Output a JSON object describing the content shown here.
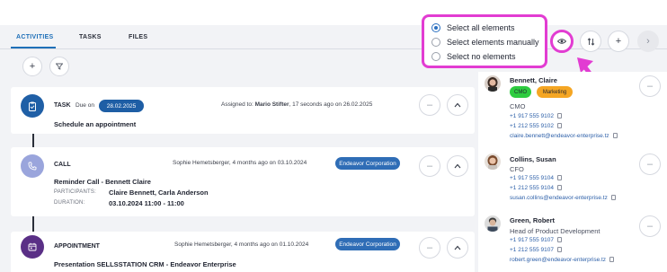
{
  "tabs": [
    {
      "label": "ACTIVITIES",
      "active": true
    },
    {
      "label": "TASKS",
      "active": false
    },
    {
      "label": "FILES",
      "active": false
    }
  ],
  "toolbar": {
    "add_symbol": "+",
    "collapse_symbol": "›"
  },
  "popup": {
    "options": [
      {
        "label": "Select all elements",
        "selected": true
      },
      {
        "label": "Select elements manually",
        "selected": false
      },
      {
        "label": "Select no elements",
        "selected": false
      }
    ]
  },
  "activities": [
    {
      "type": "TASK",
      "due_prefix": "Due on",
      "due_date": "28.02.2025",
      "meta": "Assigned to: Mario Stifter, 17 seconds ago on 26.02.2025",
      "assignee_prefix": "Assigned to: ",
      "assignee": "Mario Stifter",
      "assignee_suffix": ", 17 seconds ago on 26.02.2025",
      "title": "Schedule an appointment",
      "icon": "clipboard-icon",
      "color": "#1f5fa6"
    },
    {
      "type": "CALL",
      "author": "Sophie Hemetsberger",
      "meta_suffix": ", 4 months ago on 03.10.2024",
      "company": "Endeavor Corporation",
      "title": "Reminder Call - Bennett Claire",
      "participants_label": "PARTICIPANTS:",
      "participants": "Claire Bennett, Carla Anderson",
      "duration_label": "DURATION:",
      "duration": "03.10.2024 11:00 - 11:00",
      "icon": "phone-icon",
      "color": "#9aa5dc"
    },
    {
      "type": "APPOINTMENT",
      "author": "Sophie Hemetsberger",
      "meta_suffix": ", 4 months ago on 01.10.2024",
      "company": "Endeavor Corporation",
      "title": "Presentation SELLSSTATION CRM - Endeavor Enterprise",
      "icon": "calendar-icon",
      "color": "#5a2f86"
    }
  ],
  "contacts": [
    {
      "name": "Bennett, Claire",
      "tags": [
        {
          "label": "CMO",
          "color": "#2ecc40"
        },
        {
          "label": "Marketing",
          "color": "#f5a623"
        }
      ],
      "role": "CMO",
      "phone1": "+1 917 555 9102",
      "phone2": "+1 212 555 9102",
      "email": "claire.bennett@endeavor-enterprise.tz"
    },
    {
      "name": "Collins, Susan",
      "role": "CFO",
      "phone1": "+1 917 555 9104",
      "phone2": "+1 212 555 9104",
      "email": "susan.collins@endeavor-enterprise.tz"
    },
    {
      "name": "Green, Robert",
      "role": "Head of Product Development",
      "phone1": "+1 917 555 9107",
      "phone2": "+1 212 555 9107",
      "email": "robert.green@endeavor-enterprise.tz"
    }
  ],
  "colors": {
    "accent": "#1e6fb8",
    "highlight": "#e23cd2",
    "company_pill": "#2f6db6"
  }
}
